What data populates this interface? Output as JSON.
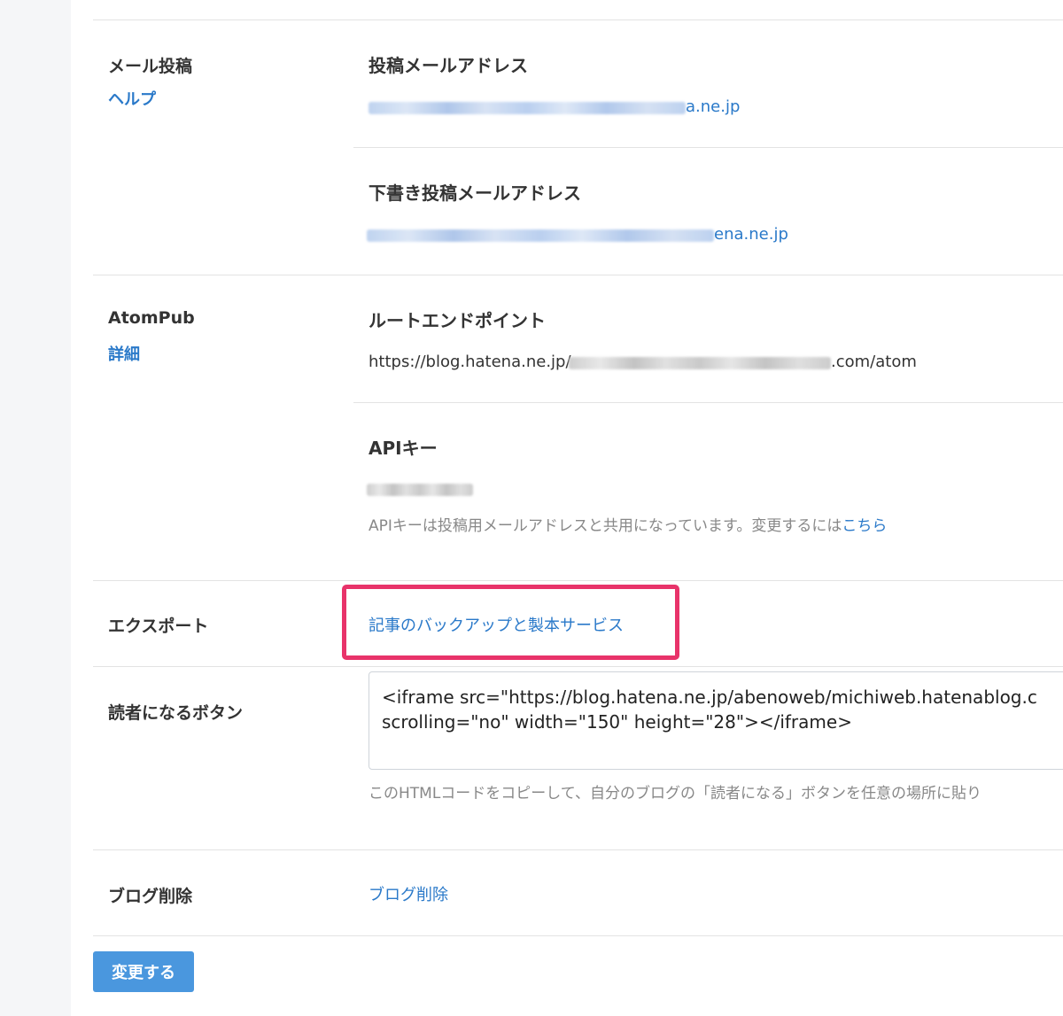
{
  "mail_post": {
    "label": "メール投稿",
    "help_link": "ヘルプ",
    "post_address_title": "投稿メールアドレス",
    "post_address_suffix": "a.ne.jp",
    "draft_address_title": "下書き投稿メールアドレス",
    "draft_address_suffix": "ena.ne.jp"
  },
  "atompub": {
    "label": "AtomPub",
    "detail_link": "詳細",
    "root_endpoint_title": "ルートエンドポイント",
    "endpoint_prefix": "https://blog.hatena.ne.jp/",
    "endpoint_suffix": ".com/atom",
    "api_key_title": "APIキー",
    "api_key_note": "APIキーは投稿用メールアドレスと共用になっています。変更するには",
    "api_key_note_link": "こちら"
  },
  "export": {
    "label": "エクスポート",
    "link": "記事のバックアップと製本サービス"
  },
  "subscribe_button": {
    "label": "読者になるボタン",
    "code": "<iframe src=\"https://blog.hatena.ne.jp/abenoweb/michiweb.hatenablog.c\nscrolling=\"no\" width=\"150\" height=\"28\"></iframe>",
    "note": "このHTMLコードをコピーして、自分のブログの「読者になる」ボタンを任意の場所に貼り"
  },
  "delete_blog": {
    "label": "ブログ削除",
    "link": "ブログ削除"
  },
  "actions": {
    "submit_label": "変更する"
  },
  "colors": {
    "link": "#2a79c9",
    "highlight": "#e8336a",
    "button": "#4a97de"
  }
}
